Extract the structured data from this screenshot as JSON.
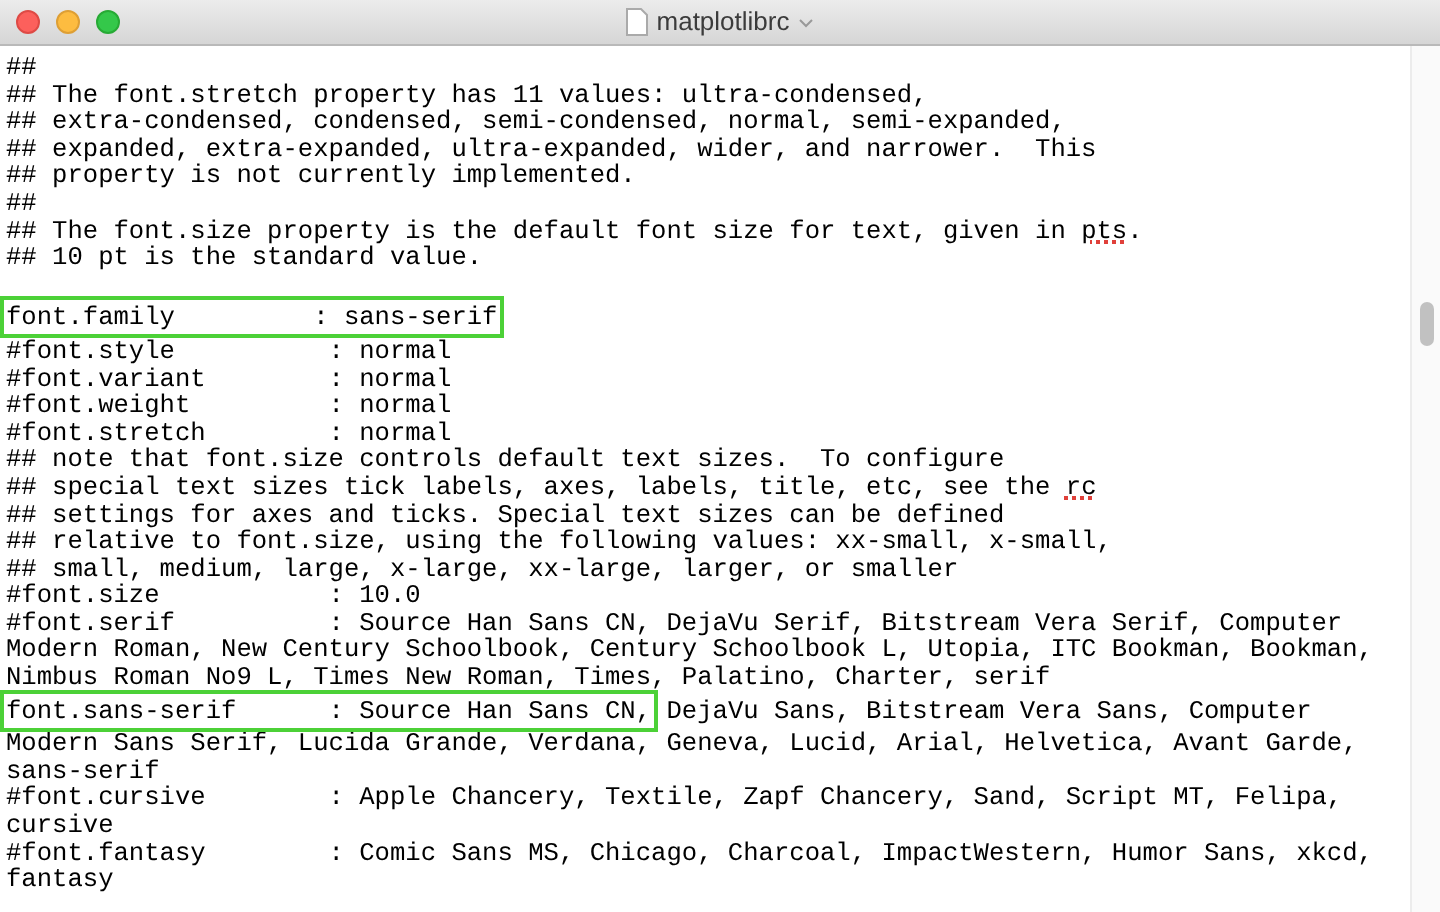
{
  "window": {
    "title": "matplotlibrc"
  },
  "lines": [
    {
      "segments": [
        {
          "text": "##",
          "kind": "plain"
        }
      ]
    },
    {
      "segments": [
        {
          "text": "## The font.stretch property has 11 values: ultra-condensed,",
          "kind": "plain"
        }
      ]
    },
    {
      "segments": [
        {
          "text": "## extra-condensed, condensed, semi-condensed, normal, semi-expanded,",
          "kind": "plain"
        }
      ]
    },
    {
      "segments": [
        {
          "text": "## expanded, extra-expanded, ultra-expanded, wider, and narrower.  This",
          "kind": "plain"
        }
      ]
    },
    {
      "segments": [
        {
          "text": "## property is not currently implemented.",
          "kind": "plain"
        }
      ]
    },
    {
      "segments": [
        {
          "text": "##",
          "kind": "plain"
        }
      ]
    },
    {
      "segments": [
        {
          "text": "## The font.size property is the default font size for text, given in ",
          "kind": "plain"
        },
        {
          "text": "pts",
          "kind": "misspelled"
        },
        {
          "text": ".",
          "kind": "plain"
        }
      ]
    },
    {
      "segments": [
        {
          "text": "## 10 pt is the standard value.",
          "kind": "plain"
        }
      ]
    },
    {
      "kind": "blank"
    },
    {
      "segments": [
        {
          "text": "font.family         : sans-serif",
          "kind": "highlighted"
        }
      ]
    },
    {
      "segments": [
        {
          "text": "#font.style          : normal",
          "kind": "plain"
        }
      ]
    },
    {
      "segments": [
        {
          "text": "#font.variant        : normal",
          "kind": "plain"
        }
      ]
    },
    {
      "segments": [
        {
          "text": "#font.weight         : normal",
          "kind": "plain"
        }
      ]
    },
    {
      "segments": [
        {
          "text": "#font.stretch        : normal",
          "kind": "plain"
        }
      ]
    },
    {
      "segments": [
        {
          "text": "## note that font.size controls default text sizes.  To configure",
          "kind": "plain"
        }
      ]
    },
    {
      "segments": [
        {
          "text": "## special text sizes tick labels, axes, labels, title, etc, see the ",
          "kind": "plain"
        },
        {
          "text": "rc",
          "kind": "misspelled"
        }
      ]
    },
    {
      "segments": [
        {
          "text": "## settings for axes and ticks. Special text sizes can be defined",
          "kind": "plain"
        }
      ]
    },
    {
      "segments": [
        {
          "text": "## relative to font.size, using the following values: xx-small, x-small,",
          "kind": "plain"
        }
      ]
    },
    {
      "segments": [
        {
          "text": "## small, medium, large, x-large, xx-large, larger, or smaller",
          "kind": "plain"
        }
      ]
    },
    {
      "segments": [
        {
          "text": "#font.size           : 10.0",
          "kind": "plain"
        }
      ]
    },
    {
      "segments": [
        {
          "text": "#font.serif          : Source Han Sans CN, DejaVu Serif, Bitstream Vera Serif, Computer",
          "kind": "plain"
        }
      ]
    },
    {
      "segments": [
        {
          "text": "Modern Roman, New Century Schoolbook, Century Schoolbook L, Utopia, ITC Bookman, Bookman,",
          "kind": "plain"
        }
      ]
    },
    {
      "segments": [
        {
          "text": "Nimbus Roman No9 L, Times New Roman, Times, Palatino, Charter, serif",
          "kind": "plain"
        }
      ]
    },
    {
      "segments": [
        {
          "text": "font.sans-serif      : Source Han Sans CN,",
          "kind": "highlighted"
        },
        {
          "text": " DejaVu Sans, Bitstream Vera Sans, Computer",
          "kind": "plain"
        }
      ]
    },
    {
      "segments": [
        {
          "text": "Modern Sans Serif, Lucida Grande, Verdana, Geneva, Lucid, Arial, Helvetica, Avant Garde,",
          "kind": "plain"
        }
      ]
    },
    {
      "segments": [
        {
          "text": "sans-serif",
          "kind": "plain"
        }
      ]
    },
    {
      "segments": [
        {
          "text": "#font.cursive        : Apple Chancery, Textile, Zapf Chancery, Sand, Script MT, Felipa,",
          "kind": "plain"
        }
      ]
    },
    {
      "segments": [
        {
          "text": "cursive",
          "kind": "plain"
        }
      ]
    },
    {
      "segments": [
        {
          "text": "#font.fantasy        : Comic Sans MS, Chicago, Charcoal, ImpactWestern, Humor Sans, xkcd,",
          "kind": "plain"
        }
      ]
    },
    {
      "segments": [
        {
          "text": "fantasy",
          "kind": "plain"
        }
      ]
    }
  ]
}
